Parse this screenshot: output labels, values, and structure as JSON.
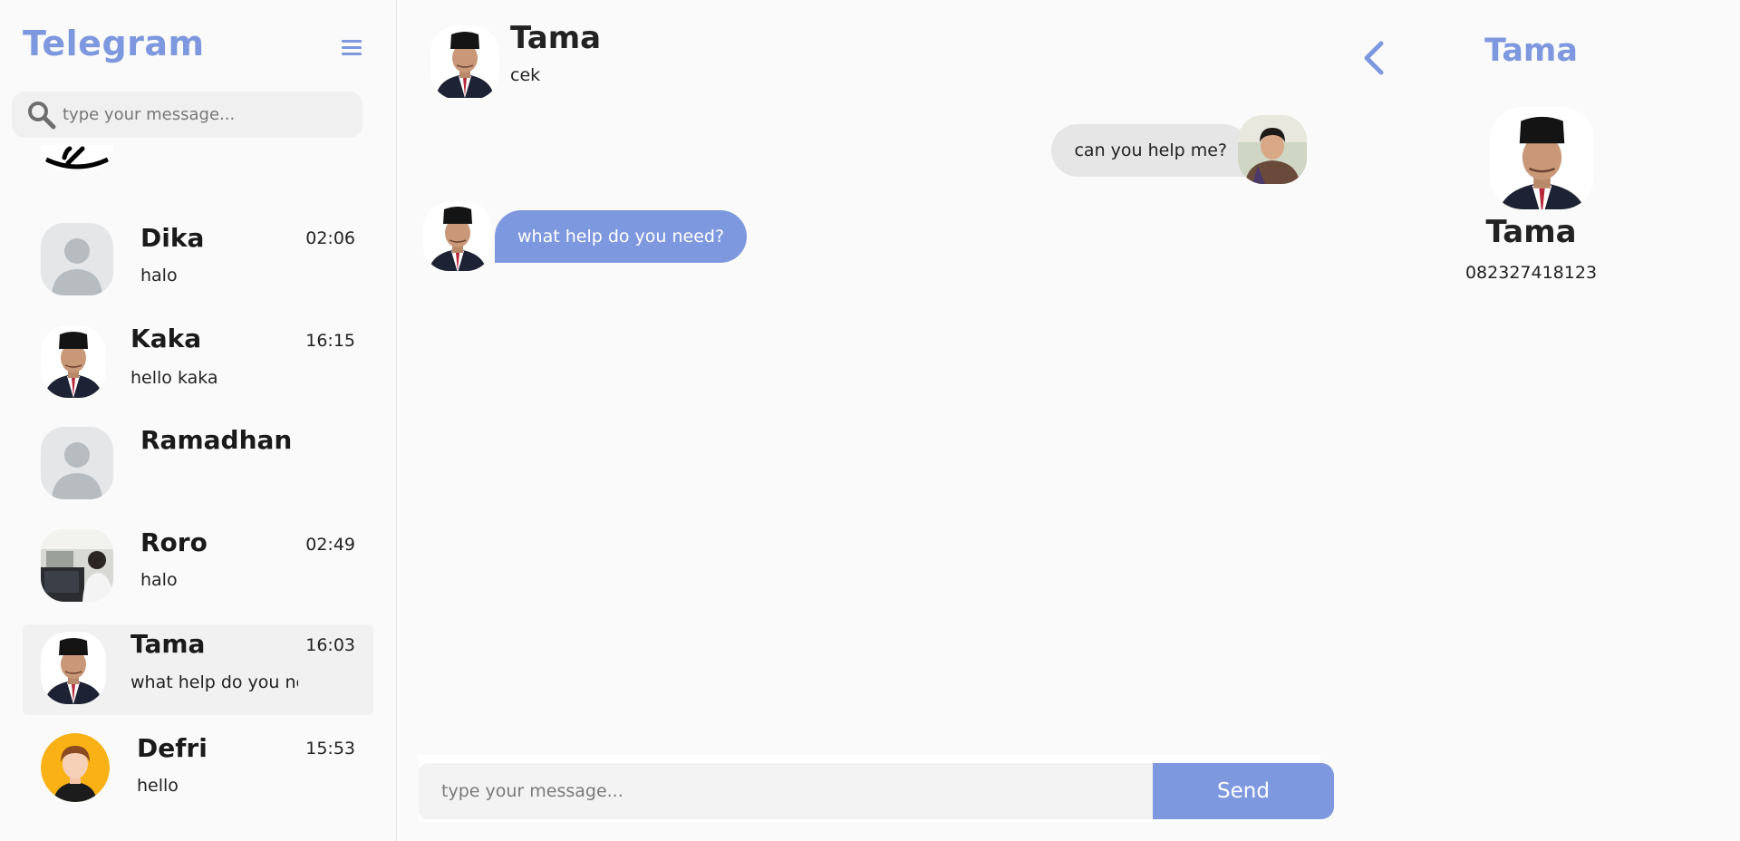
{
  "sidebar": {
    "brand": "Telegram",
    "menu_icon": "hamburger-icon",
    "search": {
      "placeholder": "type your message...",
      "icon": "search-icon"
    },
    "contacts": [
      {
        "name": "Dika",
        "message": "halo",
        "time": "02:06",
        "avatar": "default-user"
      },
      {
        "name": "Kaka",
        "message": "hello kaka",
        "time": "16:15",
        "avatar": "photo-man-peci"
      },
      {
        "name": "Ramadhan",
        "message": "",
        "time": "",
        "avatar": "default-user"
      },
      {
        "name": "Roro",
        "message": "halo",
        "time": "02:49",
        "avatar": "photo-workspace"
      },
      {
        "name": "Tama",
        "message": "what help do you need?",
        "time": "16:03",
        "avatar": "photo-man-peci",
        "active": true
      },
      {
        "name": "Defri",
        "message": "hello",
        "time": "15:53",
        "avatar": "cartoon-avatar"
      }
    ]
  },
  "chat": {
    "header": {
      "name": "Tama",
      "status": "cek"
    },
    "messages": [
      {
        "text": "can you help me?",
        "direction": "outgoing"
      },
      {
        "text": "what help do you need?",
        "direction": "incoming"
      }
    ],
    "composer": {
      "placeholder": "type your message...",
      "send_label": "Send"
    }
  },
  "profile": {
    "title": "Tama",
    "name": "Tama",
    "phone": "082327418123",
    "back_icon": "chevron-left-icon"
  },
  "colors": {
    "accent": "#7e98df",
    "background": "#fafafa",
    "outgoing_bubble": "#e6e6e6",
    "incoming_bubble": "#7e98df"
  }
}
